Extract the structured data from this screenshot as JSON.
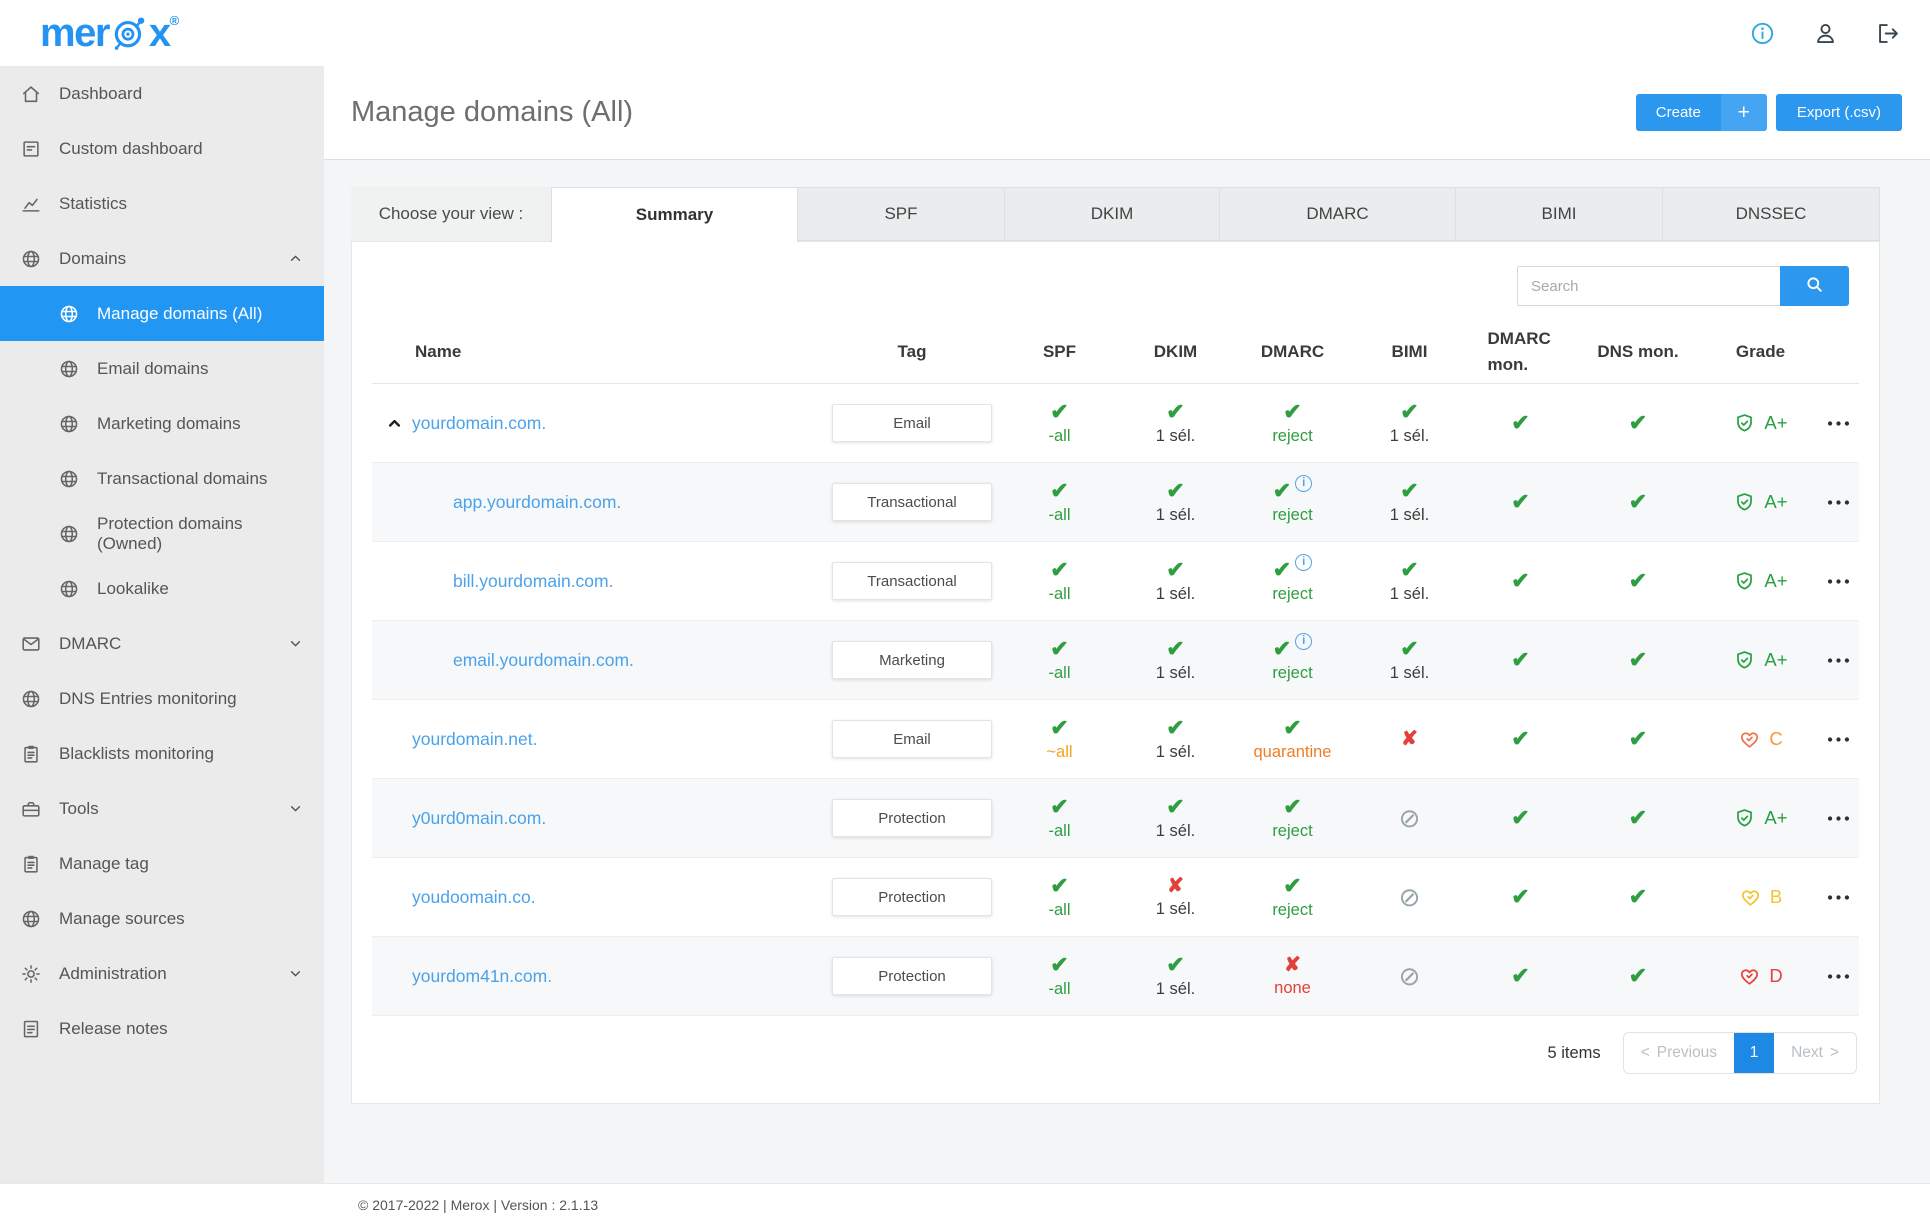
{
  "brand": {
    "part1": "mer",
    "part2": "x",
    "registered": "®"
  },
  "topbar": {
    "icons": [
      "info",
      "user",
      "logout"
    ]
  },
  "sidebar": {
    "items": [
      {
        "key": "dashboard",
        "icon": "home",
        "label": "Dashboard"
      },
      {
        "key": "custom-dashboard",
        "icon": "doc",
        "label": "Custom dashboard"
      },
      {
        "key": "statistics",
        "icon": "chart",
        "label": "Statistics"
      },
      {
        "key": "domains",
        "icon": "globe",
        "label": "Domains",
        "chevron": "up"
      },
      {
        "key": "manage-domains-all",
        "icon": "globe",
        "label": "Manage domains (All)",
        "sub": true,
        "active": true
      },
      {
        "key": "email-domains",
        "icon": "globe",
        "label": "Email domains",
        "sub": true
      },
      {
        "key": "marketing-domains",
        "icon": "globe",
        "label": "Marketing domains",
        "sub": true
      },
      {
        "key": "transactional-domains",
        "icon": "globe",
        "label": "Transactional domains",
        "sub": true
      },
      {
        "key": "protection-domains-owned",
        "icon": "globe",
        "label": "Protection domains (Owned)",
        "sub": true
      },
      {
        "key": "lookalike",
        "icon": "globe",
        "label": "Lookalike",
        "sub": true
      },
      {
        "key": "dmarc",
        "icon": "mail",
        "label": "DMARC",
        "chevron": "down"
      },
      {
        "key": "dns-entries-monitoring",
        "icon": "globe",
        "label": "DNS Entries monitoring"
      },
      {
        "key": "blacklists-monitoring",
        "icon": "clipboard",
        "label": "Blacklists monitoring"
      },
      {
        "key": "tools",
        "icon": "toolbox",
        "label": "Tools",
        "chevron": "down"
      },
      {
        "key": "manage-tag",
        "icon": "clipboard",
        "label": "Manage tag"
      },
      {
        "key": "manage-sources",
        "icon": "globe",
        "label": "Manage sources"
      },
      {
        "key": "administration",
        "icon": "gear",
        "label": "Administration",
        "chevron": "down"
      },
      {
        "key": "release-notes",
        "icon": "notes",
        "label": "Release notes"
      }
    ]
  },
  "page": {
    "title": "Manage domains (All)",
    "create_label": "Create",
    "create_plus": "+",
    "export_label": "Export (.csv)"
  },
  "tabs": {
    "label": "Choose your view :",
    "items": [
      {
        "label": "Summary",
        "active": true
      },
      {
        "label": "SPF"
      },
      {
        "label": "DKIM"
      },
      {
        "label": "DMARC"
      },
      {
        "label": "BIMI"
      },
      {
        "label": "DNSSEC"
      }
    ]
  },
  "search": {
    "placeholder": "Search"
  },
  "table": {
    "columns": [
      "Name",
      "Tag",
      "SPF",
      "DKIM",
      "DMARC",
      "BIMI",
      "DMARC mon.",
      "DNS mon.",
      "Grade"
    ],
    "rows": [
      {
        "name": "yourdomain.com.",
        "caret": true,
        "indent": false,
        "tag": "Email",
        "spf": {
          "mark": "check",
          "text": "-all",
          "tone": "green"
        },
        "dkim": {
          "mark": "check",
          "text": "1 sél.",
          "tone": "dark"
        },
        "dmarc": {
          "mark": "check",
          "info": false,
          "text": "reject",
          "tone": "green"
        },
        "bimi": {
          "mark": "check",
          "text": "1 sél.",
          "tone": "dark"
        },
        "dmarc_mon": "check",
        "dns_mon": "check",
        "grade": {
          "shape": "shield",
          "letter": "A+",
          "icon_color": "#27a144",
          "letter_color": "#27a144"
        }
      },
      {
        "name": "app.yourdomain.com.",
        "caret": false,
        "indent": true,
        "tag": "Transactional",
        "spf": {
          "mark": "check",
          "text": "-all",
          "tone": "green"
        },
        "dkim": {
          "mark": "check",
          "text": "1 sél.",
          "tone": "dark"
        },
        "dmarc": {
          "mark": "check",
          "info": true,
          "text": "reject",
          "tone": "green"
        },
        "bimi": {
          "mark": "check",
          "text": "1 sél.",
          "tone": "dark"
        },
        "dmarc_mon": "check",
        "dns_mon": "check",
        "grade": {
          "shape": "shield",
          "letter": "A+",
          "icon_color": "#27a144",
          "letter_color": "#27a144"
        }
      },
      {
        "name": "bill.yourdomain.com.",
        "caret": false,
        "indent": true,
        "tag": "Transactional",
        "spf": {
          "mark": "check",
          "text": "-all",
          "tone": "green"
        },
        "dkim": {
          "mark": "check",
          "text": "1 sél.",
          "tone": "dark"
        },
        "dmarc": {
          "mark": "check",
          "info": true,
          "text": "reject",
          "tone": "green"
        },
        "bimi": {
          "mark": "check",
          "text": "1 sél.",
          "tone": "dark"
        },
        "dmarc_mon": "check",
        "dns_mon": "check",
        "grade": {
          "shape": "shield",
          "letter": "A+",
          "icon_color": "#27a144",
          "letter_color": "#27a144"
        }
      },
      {
        "name": "email.yourdomain.com.",
        "caret": false,
        "indent": true,
        "tag": "Marketing",
        "spf": {
          "mark": "check",
          "text": "-all",
          "tone": "green"
        },
        "dkim": {
          "mark": "check",
          "text": "1 sél.",
          "tone": "dark"
        },
        "dmarc": {
          "mark": "check",
          "info": true,
          "text": "reject",
          "tone": "green"
        },
        "bimi": {
          "mark": "check",
          "text": "1 sél.",
          "tone": "dark"
        },
        "dmarc_mon": "check",
        "dns_mon": "check",
        "grade": {
          "shape": "shield",
          "letter": "A+",
          "icon_color": "#27a144",
          "letter_color": "#27a144"
        }
      },
      {
        "name": "yourdomain.net.",
        "caret": false,
        "indent": false,
        "tag": "Email",
        "spf": {
          "mark": "check",
          "text": "~all",
          "tone": "amber"
        },
        "dkim": {
          "mark": "check",
          "text": "1 sél.",
          "tone": "dark"
        },
        "dmarc": {
          "mark": "check",
          "info": false,
          "text": "quarantine",
          "tone": "orange"
        },
        "bimi": {
          "mark": "cross"
        },
        "dmarc_mon": "check",
        "dns_mon": "check",
        "grade": {
          "shape": "heart",
          "letter": "C",
          "icon_color": "#f2714d",
          "letter_color": "#f29a3d"
        }
      },
      {
        "name": "y0urd0main.com.",
        "caret": false,
        "indent": false,
        "tag": "Protection",
        "spf": {
          "mark": "check",
          "text": "-all",
          "tone": "green"
        },
        "dkim": {
          "mark": "check",
          "text": "1 sél.",
          "tone": "dark"
        },
        "dmarc": {
          "mark": "check",
          "info": false,
          "text": "reject",
          "tone": "green"
        },
        "bimi": {
          "mark": "slash"
        },
        "dmarc_mon": "check",
        "dns_mon": "check",
        "grade": {
          "shape": "shield",
          "letter": "A+",
          "icon_color": "#27a144",
          "letter_color": "#27a144"
        }
      },
      {
        "name": "youdoomain.co.",
        "caret": false,
        "indent": false,
        "tag": "Protection",
        "spf": {
          "mark": "check",
          "text": "-all",
          "tone": "green"
        },
        "dkim": {
          "mark": "cross",
          "text": "1 sél.",
          "tone": "dark"
        },
        "dmarc": {
          "mark": "check",
          "info": false,
          "text": "reject",
          "tone": "green"
        },
        "bimi": {
          "mark": "slash"
        },
        "dmarc_mon": "check",
        "dns_mon": "check",
        "grade": {
          "shape": "heart",
          "letter": "B",
          "icon_color": "#f2c430",
          "letter_color": "#f2c430"
        }
      },
      {
        "name": "yourdom41n.com.",
        "caret": false,
        "indent": false,
        "tag": "Protection",
        "spf": {
          "mark": "check",
          "text": "-all",
          "tone": "green"
        },
        "dkim": {
          "mark": "check",
          "text": "1 sél.",
          "tone": "dark"
        },
        "dmarc": {
          "mark": "cross",
          "info": false,
          "text": "none",
          "tone": "red"
        },
        "bimi": {
          "mark": "slash"
        },
        "dmarc_mon": "check",
        "dns_mon": "check",
        "grade": {
          "shape": "heart",
          "letter": "D",
          "icon_color": "#e8413c",
          "letter_color": "#e8413c"
        }
      }
    ]
  },
  "pagination": {
    "count": "5 items",
    "prev_arrow": "<",
    "prev": "Previous",
    "page": "1",
    "next": "Next",
    "next_arrow": ">"
  },
  "footer": {
    "copyright": "© 2017-2022 | Merox | Version : 2.1.13"
  },
  "colors": {
    "accent": "#2b97ee",
    "sidebar_active": "#2196f3",
    "link": "#4ba2ea",
    "check_green": "#2f9e41",
    "cross_red": "#e2403a",
    "slash_gray": "#97a4ac",
    "info_blue": "#54a4ea",
    "warn_orange": "#ee7d28",
    "warn_amber": "#f2a41b",
    "grade_green": "#27a144",
    "grade_yellow": "#f2c430",
    "grade_red": "#e8413c",
    "page_active": "#1e88e5"
  }
}
